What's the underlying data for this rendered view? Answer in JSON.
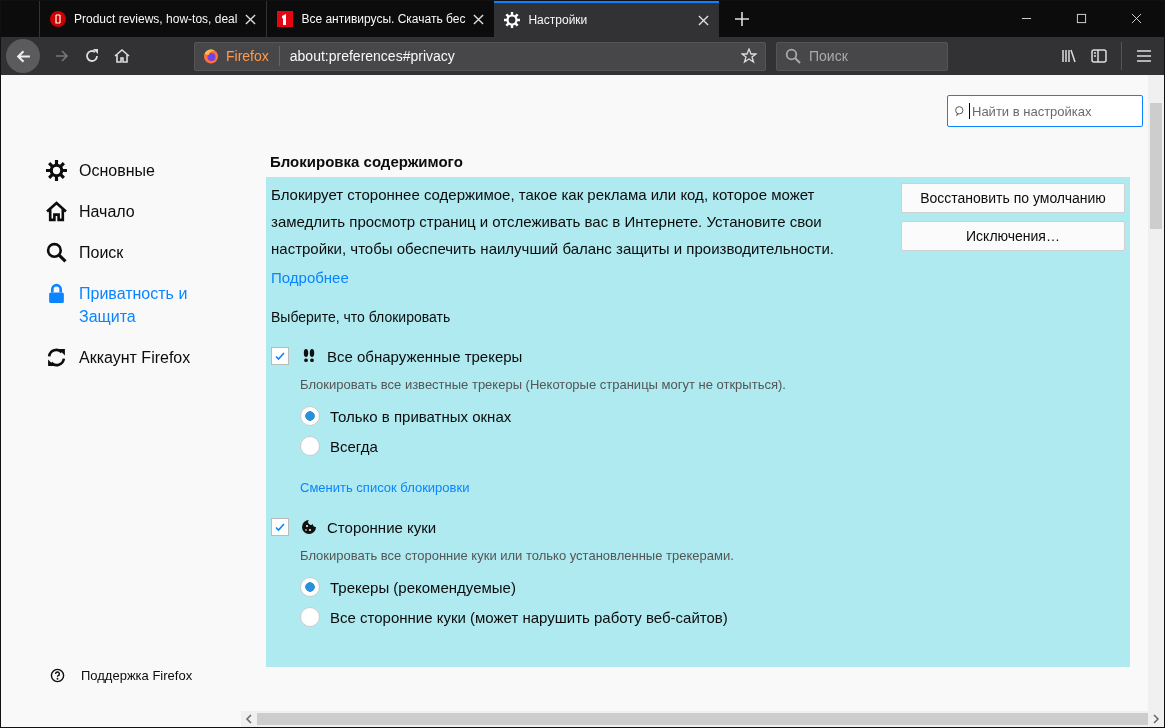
{
  "tabs": [
    {
      "title": "Product reviews, how-tos, deal",
      "selected": false
    },
    {
      "title": "Все антивирусы. Скачать бес",
      "selected": false
    },
    {
      "title": "Настройки",
      "selected": true
    }
  ],
  "toolbar": {
    "identity": "Firefox",
    "url": "about:preferences#privacy",
    "search_placeholder": "Поиск"
  },
  "settings_search": {
    "placeholder": "Найти в настройках"
  },
  "sidebar": {
    "items": [
      {
        "label": "Основные",
        "selected": false
      },
      {
        "label": "Начало",
        "selected": false
      },
      {
        "label": "Поиск",
        "selected": false
      },
      {
        "label": "Приватность и Защита",
        "selected": true
      },
      {
        "label": "Аккаунт Firefox",
        "selected": false
      }
    ],
    "support": "Поддержка Firefox"
  },
  "section": {
    "title": "Блокировка содержимого",
    "description": "Блокирует стороннее содержимое, такое как реклама или код, которое может замедлить просмотр страниц и отслеживать вас в Интернете. Установите свои настройки, чтобы обеспечить наилучший баланс защиты и производительности.",
    "learn_more": "Подробнее",
    "buttons": [
      "Восстановить по умолчанию",
      "Исключения…"
    ],
    "prompt": "Выберите, что блокировать",
    "options": [
      {
        "label": "Все обнаруженные трекеры",
        "checked": true,
        "hint": "Блокировать все известные трекеры (Некоторые страницы могут не открыться).",
        "choices": [
          {
            "label": "Только в приватных окнах",
            "selected": true
          },
          {
            "label": "Всегда",
            "selected": false
          }
        ],
        "link": "Сменить список блокировки"
      },
      {
        "label": "Сторонние куки",
        "checked": true,
        "hint": "Блокировать все сторонние куки или только установленные трекерами.",
        "choices": [
          {
            "label": "Трекеры (рекомендуемые)",
            "selected": true
          },
          {
            "label": "Все сторонние куки (может нарушить работу веб-сайтов)",
            "selected": false
          }
        ]
      }
    ]
  }
}
